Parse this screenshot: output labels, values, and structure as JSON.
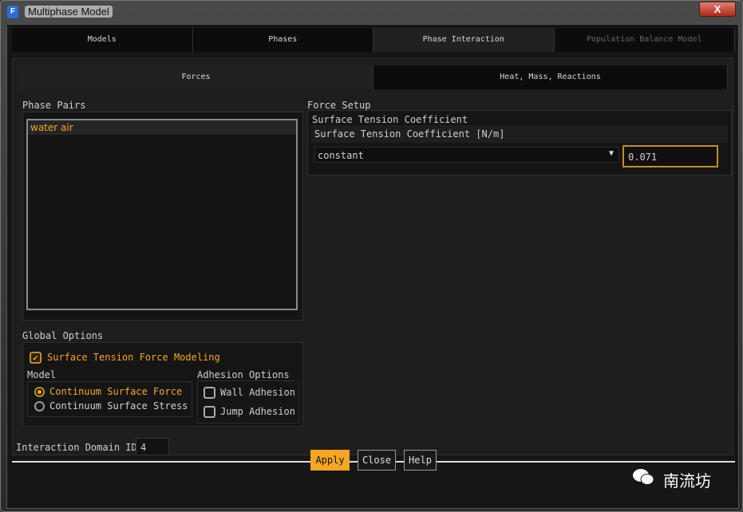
{
  "window": {
    "title": "Multiphase Model",
    "icon_letter": "F",
    "close_label": "X"
  },
  "tabs": [
    "Models",
    "Phases",
    "Phase Interaction",
    "Population Balance Model"
  ],
  "subtabs": [
    "Forces",
    "Heat, Mass, Reactions"
  ],
  "phase_pairs": {
    "label": "Phase Pairs",
    "items": [
      "water air"
    ]
  },
  "force_setup": {
    "label": "Force Setup",
    "group": "Surface Tension Coefficient",
    "field_label": "Surface Tension Coefficient [N/m]",
    "method": "constant",
    "value": "0.071"
  },
  "global_options": {
    "label": "Global Options",
    "surface_tension_label": "Surface Tension Force Modeling",
    "surface_tension_checked": true,
    "model_label": "Model",
    "models": [
      "Continuum Surface Force",
      "Continuum Surface Stress"
    ],
    "adhesion_label": "Adhesion Options",
    "adhesion": [
      "Wall Adhesion",
      "Jump Adhesion"
    ]
  },
  "domain": {
    "label": "Interaction Domain ID",
    "value": "4"
  },
  "buttons": {
    "apply": "Apply",
    "close": "Close",
    "help": "Help"
  },
  "watermark": "南流坊",
  "colors": {
    "accent": "#f5a623"
  }
}
